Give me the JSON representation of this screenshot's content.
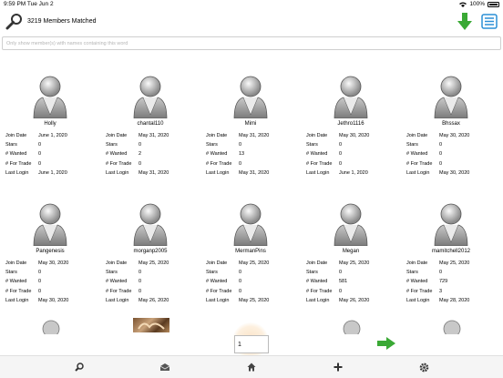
{
  "status_bar": {
    "time_date": "9:59 PM  Tue Jun 2",
    "battery_percent": "100%"
  },
  "header": {
    "match_count": "3219 Members Matched"
  },
  "filter": {
    "placeholder": "Only show member(s) with names containing this word"
  },
  "labels": {
    "join_date": "Join Date",
    "stars": "Stars",
    "wanted": "# Wanted",
    "for_trade": "# For Trade",
    "last_login": "Last Login"
  },
  "members": [
    {
      "name": "Holly",
      "join_date": "June 1, 2020",
      "stars": "0",
      "wanted": "0",
      "for_trade": "0",
      "last_login": "June 1, 2020"
    },
    {
      "name": "chantal110",
      "join_date": "May 31, 2020",
      "stars": "0",
      "wanted": "2",
      "for_trade": "0",
      "last_login": "May 31, 2020"
    },
    {
      "name": "Mimi",
      "join_date": "May 31, 2020",
      "stars": "0",
      "wanted": "13",
      "for_trade": "0",
      "last_login": "May 31, 2020"
    },
    {
      "name": "Jethro1116",
      "join_date": "May 30, 2020",
      "stars": "0",
      "wanted": "0",
      "for_trade": "0",
      "last_login": "June 1, 2020"
    },
    {
      "name": "Bhssax",
      "join_date": "May 30, 2020",
      "stars": "0",
      "wanted": "0",
      "for_trade": "0",
      "last_login": "May 30, 2020"
    },
    {
      "name": "Pangenesis",
      "join_date": "May 30, 2020",
      "stars": "0",
      "wanted": "0",
      "for_trade": "0",
      "last_login": "May 30, 2020"
    },
    {
      "name": "morganp2005",
      "join_date": "May 25, 2020",
      "stars": "0",
      "wanted": "0",
      "for_trade": "0",
      "last_login": "May 26, 2020"
    },
    {
      "name": "MermanPins",
      "join_date": "May 25, 2020",
      "stars": "0",
      "wanted": "0",
      "for_trade": "0",
      "last_login": "May 25, 2020"
    },
    {
      "name": "Megan",
      "join_date": "May 25, 2020",
      "stars": "0",
      "wanted": "581",
      "for_trade": "0",
      "last_login": "May 26, 2020"
    },
    {
      "name": "mamitchell2012",
      "join_date": "May 25, 2020",
      "stars": "0",
      "wanted": "729",
      "for_trade": "3",
      "last_login": "May 28, 2020"
    }
  ],
  "pagination": {
    "page_value": "1"
  },
  "icons": {
    "search": "search-icon",
    "download": "download-arrow-icon",
    "list": "list-icon",
    "next": "next-arrow-icon",
    "tabs": [
      "search-tab-icon",
      "mail-tab-icon",
      "home-tab-icon",
      "add-tab-icon",
      "settings-tab-icon"
    ]
  },
  "colors": {
    "accent_green": "#3aa935",
    "accent_blue": "#2a8fd6",
    "avatar_gray": "#8f8f8f"
  }
}
